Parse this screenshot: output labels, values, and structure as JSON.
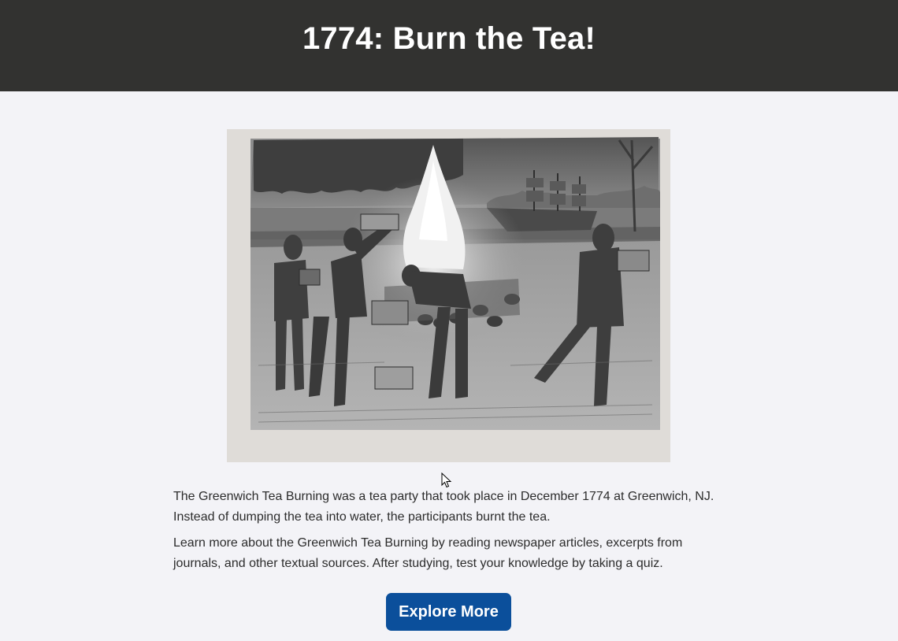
{
  "header": {
    "title": "1774: Burn the Tea!"
  },
  "illustration": {
    "alt": "Pencil drawing of colonists burning tea chests on a bonfire beside a river with a ship in the background"
  },
  "content": {
    "paragraph_1": "The Greenwich Tea Burning was a tea party that took place in December 1774 at Greenwich, NJ. Instead of dumping the tea into water, the participants burnt the tea.",
    "paragraph_2": "Learn more about the Greenwich Tea Burning by reading newspaper articles, excerpts from journals, and other textual sources. After studying, test your knowledge by taking a quiz."
  },
  "cta": {
    "label": "Explore More"
  },
  "colors": {
    "header_bg": "#323230",
    "page_bg": "#f3f3f7",
    "button_bg": "#0b4f9b",
    "text": "#2c2c2c"
  }
}
